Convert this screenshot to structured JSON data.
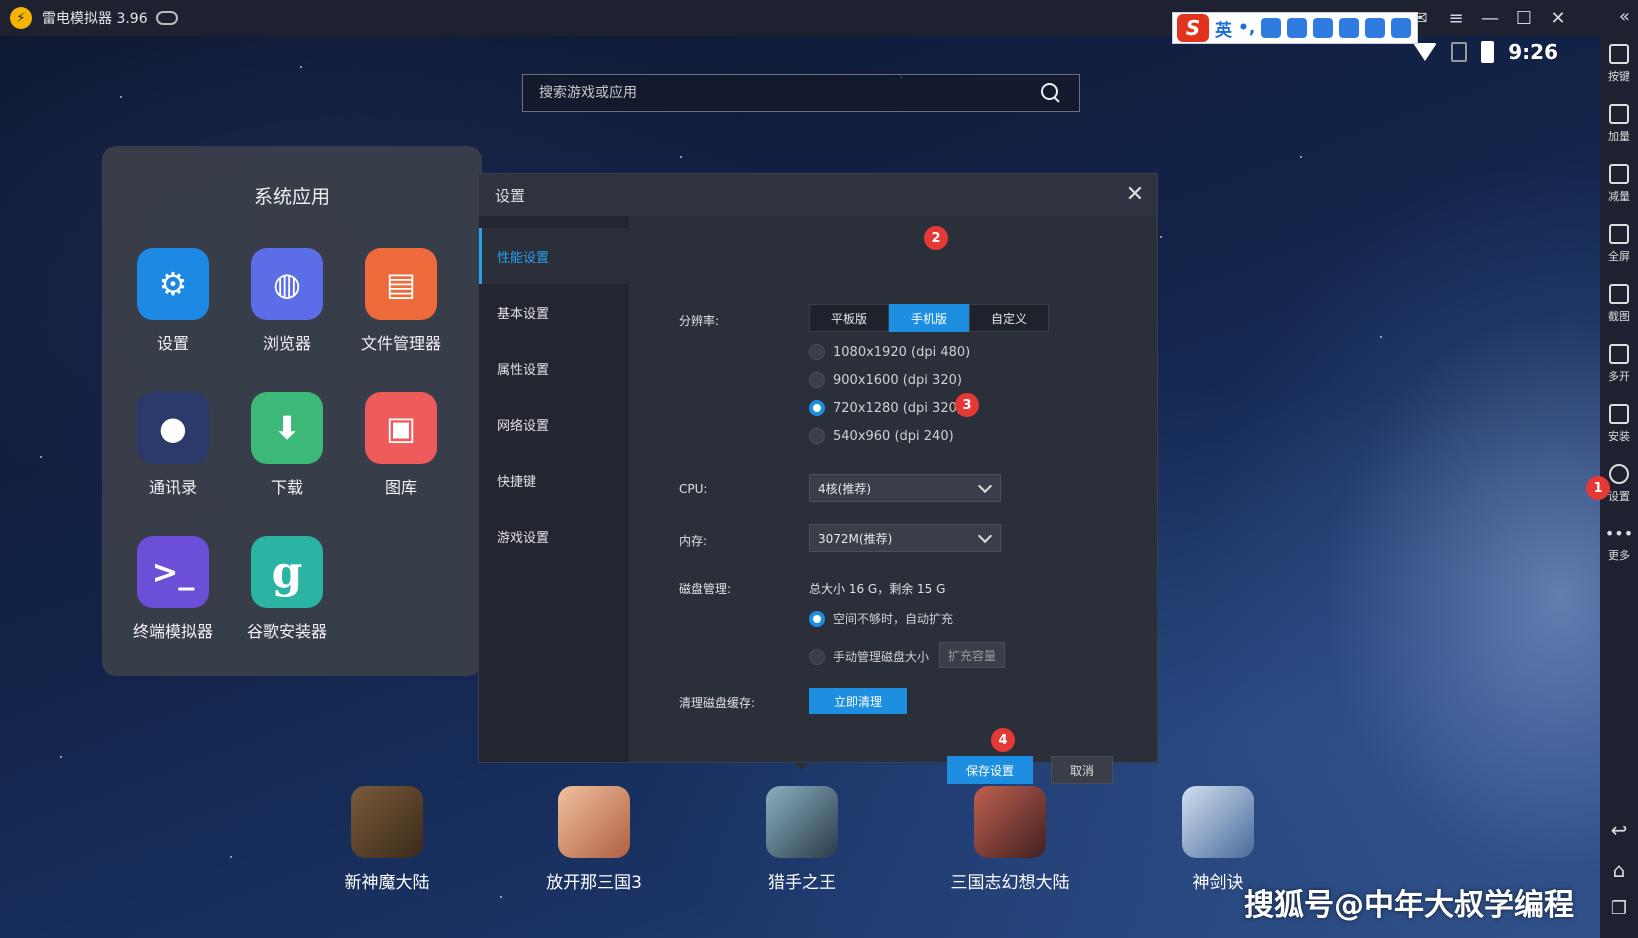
{
  "window": {
    "title": "雷电模拟器 3.96",
    "clock": "9:26",
    "ime_lang": "英"
  },
  "search": {
    "placeholder": "搜索游戏或应用"
  },
  "sysfolder": {
    "title": "系统应用",
    "apps": [
      {
        "label": "设置",
        "icon": "gear-icon",
        "color": "#1e88e5"
      },
      {
        "label": "浏览器",
        "icon": "globe-icon",
        "color": "#5b6ee8"
      },
      {
        "label": "文件管理器",
        "icon": "folder-icon",
        "color": "#ef6a3a"
      },
      {
        "label": "通讯录",
        "icon": "person-icon",
        "color": "#2b3a6b"
      },
      {
        "label": "下载",
        "icon": "download-icon",
        "color": "#3cb878"
      },
      {
        "label": "图库",
        "icon": "image-icon",
        "color": "#ef5a5a"
      },
      {
        "label": "终端模拟器",
        "icon": "terminal-icon",
        "color": "#6b4fd8"
      },
      {
        "label": "谷歌安装器",
        "icon": "g-icon",
        "color": "#2bb3a3"
      }
    ]
  },
  "dock": [
    {
      "label": "新神魔大陆",
      "color": "#5a4632"
    },
    {
      "label": "放开那三国3",
      "color": "#d89a6a"
    },
    {
      "label": "猎手之王",
      "color": "#5a7a8a"
    },
    {
      "label": "三国志幻想大陆",
      "color": "#8a4a3a"
    },
    {
      "label": "神剑诀",
      "color": "#8aa8c8"
    }
  ],
  "settings": {
    "title": "设置",
    "nav": [
      "性能设置",
      "基本设置",
      "属性设置",
      "网络设置",
      "快捷键",
      "游戏设置"
    ],
    "active_nav": 0,
    "resolution_label": "分辨率:",
    "resolution_tabs": [
      "平板版",
      "手机版",
      "自定义"
    ],
    "resolution_active": 1,
    "resolutions": [
      "1080x1920  (dpi 480)",
      "900x1600  (dpi 320)",
      "720x1280  (dpi 320)",
      "540x960  (dpi 240)"
    ],
    "resolution_selected": 2,
    "cpu_label": "CPU:",
    "cpu_value": "4核(推荐)",
    "mem_label": "内存:",
    "mem_value": "3072M(推荐)",
    "disk_label": "磁盘管理:",
    "disk_info": "总大小 16 G，剩余 15 G",
    "disk_opt1": "空间不够时，自动扩充",
    "disk_opt2": "手动管理磁盘大小",
    "expand_btn": "扩充容量",
    "clean_label": "清理磁盘缓存:",
    "clean_btn": "立即清理",
    "save_btn": "保存设置",
    "cancel_btn": "取消"
  },
  "badges": [
    "1",
    "2",
    "3",
    "4"
  ],
  "toolbar": [
    "按键",
    "加量",
    "减量",
    "全屏",
    "截图",
    "多开",
    "安装",
    "设置",
    "更多"
  ],
  "watermark": "搜狐号@中年大叔学编程"
}
